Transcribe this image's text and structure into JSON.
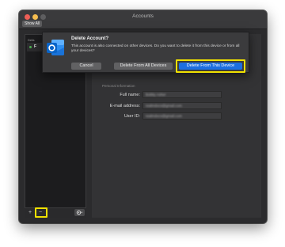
{
  "window": {
    "title": "Accounts",
    "show_all_label": "Show All"
  },
  "sidebar": {
    "header": "Defa",
    "account_initial": "F",
    "add_label": "+",
    "remove_label": "−"
  },
  "account_details": {
    "section_label": "Personal Information",
    "full_name_label": "Full name:",
    "full_name_value": "Bobby Asher",
    "email_label": "E-mail address:",
    "email_value": "realmdocs@gmail.com",
    "user_id_label": "User ID:",
    "user_id_value": "realmdocs@gmail.com"
  },
  "dialog": {
    "title": "Delete Account?",
    "message": "This account is also connected on other devices. Do you want to delete it from this device or from all your devices?",
    "cancel_label": "Cancel",
    "delete_all_label": "Delete From All Devices",
    "delete_this_label": "Delete From This Device"
  },
  "colors": {
    "highlight": "#f0e100",
    "primary_button": "#1d6fe0",
    "outlook_blue": "#0a64c8"
  }
}
